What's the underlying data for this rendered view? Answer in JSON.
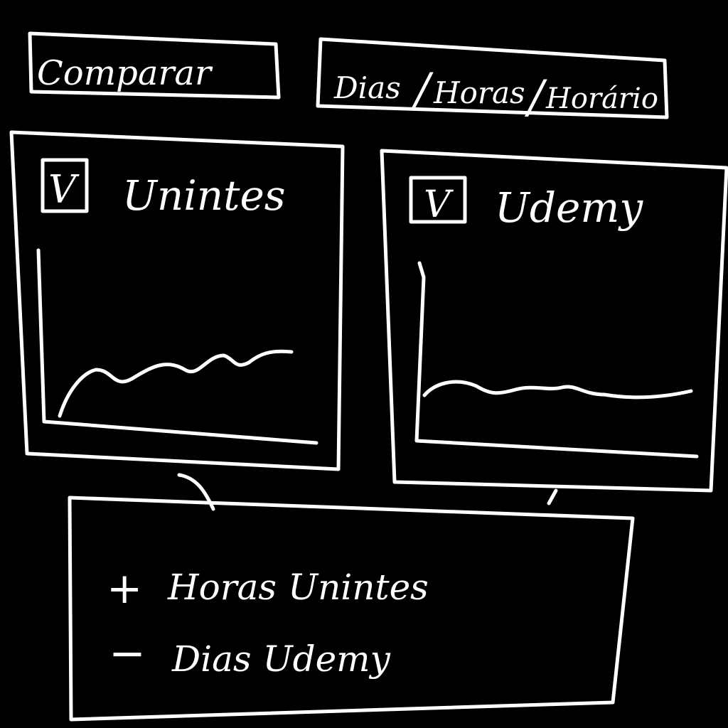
{
  "compare_button": {
    "label": "Comparar"
  },
  "mode_selector": {
    "options": [
      "Dias",
      "Horas",
      "Horário"
    ],
    "separator": "/"
  },
  "panels": [
    {
      "checked": true,
      "checkbox_mark": "V",
      "title": "Unintes"
    },
    {
      "checked": true,
      "checkbox_mark": "V",
      "title": "Udemy"
    }
  ],
  "summary": {
    "items": [
      {
        "sign": "+",
        "text": "Horas Unintes"
      },
      {
        "sign": "−",
        "text": "Dias Udemy"
      }
    ]
  }
}
